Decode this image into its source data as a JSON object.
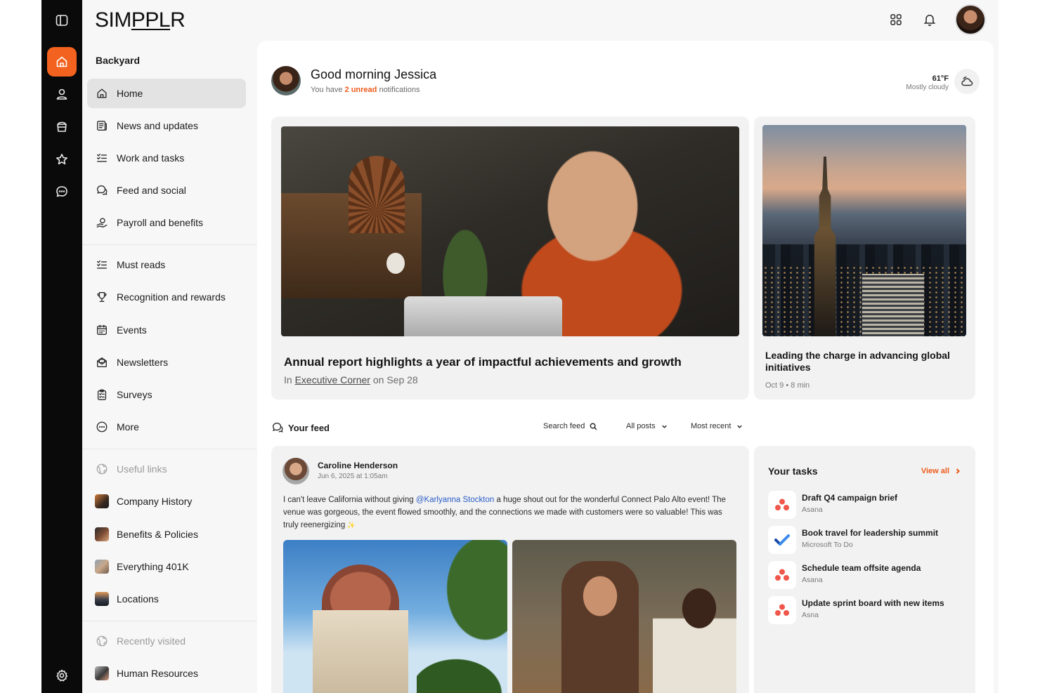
{
  "brand": {
    "logo_text": "SIMPPLR",
    "accent_color": "#f4621f"
  },
  "rail": {
    "icons": [
      "sidebar-toggle-icon",
      "home-icon",
      "profile-icon",
      "sites-icon",
      "favorites-icon",
      "messages-icon",
      "settings-icon"
    ]
  },
  "sidebar": {
    "section_title": "Backyard",
    "primary": [
      {
        "label": "Home",
        "icon": "home-icon",
        "active": true
      },
      {
        "label": "News and updates",
        "icon": "news-icon"
      },
      {
        "label": "Work and tasks",
        "icon": "tasks-list-icon"
      },
      {
        "label": "Feed and social",
        "icon": "feed-icon"
      },
      {
        "label": "Payroll and benefits",
        "icon": "payroll-icon"
      }
    ],
    "secondary": [
      {
        "label": "Must reads",
        "icon": "checklist-icon"
      },
      {
        "label": "Recognition and rewards",
        "icon": "trophy-icon"
      },
      {
        "label": "Events",
        "icon": "calendar-icon"
      },
      {
        "label": "Newsletters",
        "icon": "newsletter-icon"
      },
      {
        "label": "Surveys",
        "icon": "survey-icon"
      },
      {
        "label": "More",
        "icon": "more-icon"
      }
    ],
    "useful_links_title": "Useful links",
    "useful_links": [
      {
        "label": "Company History"
      },
      {
        "label": "Benefits & Policies"
      },
      {
        "label": "Everything 401K"
      },
      {
        "label": "Locations"
      }
    ],
    "recently_visited_title": "Recently visited",
    "recently_visited": [
      {
        "label": "Human Resources"
      }
    ]
  },
  "header": {
    "icons": [
      "apps-grid-icon",
      "bell-icon"
    ],
    "user_avatar": "user-avatar"
  },
  "greeting": {
    "title": "Good morning Jessica",
    "sub_prefix": "You have ",
    "sub_highlight": "2 unread",
    "sub_suffix": " notifications"
  },
  "weather": {
    "temp": "61°F",
    "condition": "Mostly cloudy"
  },
  "hero": {
    "title": "Annual report highlights a year of impactful achievements and growth",
    "meta_prefix": "In ",
    "meta_link": "Executive Corner",
    "meta_suffix": " on Sep 28"
  },
  "side_story": {
    "title": "Leading the charge in advancing global initiatives",
    "date": "Oct 9",
    "read_time": "8 min"
  },
  "feed": {
    "title": "Your feed",
    "search_label": "Search feed",
    "filter_label": "All posts",
    "sort_label": "Most recent"
  },
  "post": {
    "author": "Caroline Henderson",
    "date": "Jun 6, 2025 at 1:05am",
    "body_before": "I can't leave California without giving ",
    "mention": "@Karlyanna Stockton",
    "body_after": " a huge shout out for the wonderful Connect Palo Alto event! The venue was gorgeous, the event flowed smoothly, and the connections we made with customers were so valuable! This was truly reenergizing",
    "sparkle": "✨"
  },
  "tasks": {
    "title": "Your tasks",
    "view_all": "View all",
    "items": [
      {
        "title": "Draft Q4 campaign brief",
        "source": "Asana",
        "icon": "asana-icon"
      },
      {
        "title": "Book travel for leadership summit",
        "source": "Microsoft To Do",
        "icon": "microsoft-todo-icon"
      },
      {
        "title": "Schedule team offsite agenda",
        "source": "Asana",
        "icon": "asana-icon"
      },
      {
        "title": "Update sprint board with new items",
        "source": "Asna",
        "icon": "asana-icon"
      }
    ]
  }
}
